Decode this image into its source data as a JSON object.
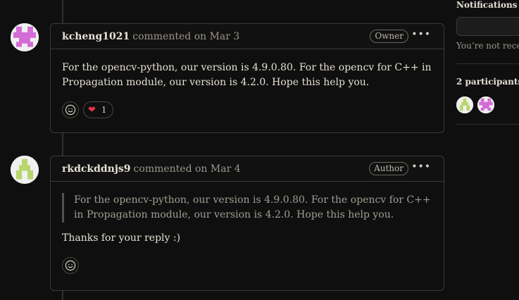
{
  "comments": [
    {
      "author": "kcheng1021",
      "meta": "commented on Mar 3",
      "badge": "Owner",
      "avatar_color": "#d46bd6",
      "body": "For the opencv-python, our version is 4.9.0.80. For the opencv for C++ in Propagation module, our version is 4.2.0. Hope this help you.",
      "reactions": [
        {
          "emoji": "heart",
          "count": "1"
        }
      ]
    },
    {
      "author": "rkdckddnjs9",
      "meta": "commented on Mar 4",
      "badge": "Author",
      "avatar_color": "#b9d66b",
      "quote": "For the opencv-python, our version is 4.9.0.80. For the opencv for C++ in Propagation module, our version is 4.2.0. Hope this help you.",
      "body": "Thanks for your reply :)"
    }
  ],
  "sidebar": {
    "notifications_title": "Notifications",
    "notifications_note": "You’re not receiving",
    "participants_title": "2 participants",
    "participant_colors": [
      "#b9d66b",
      "#d46bd6"
    ]
  }
}
